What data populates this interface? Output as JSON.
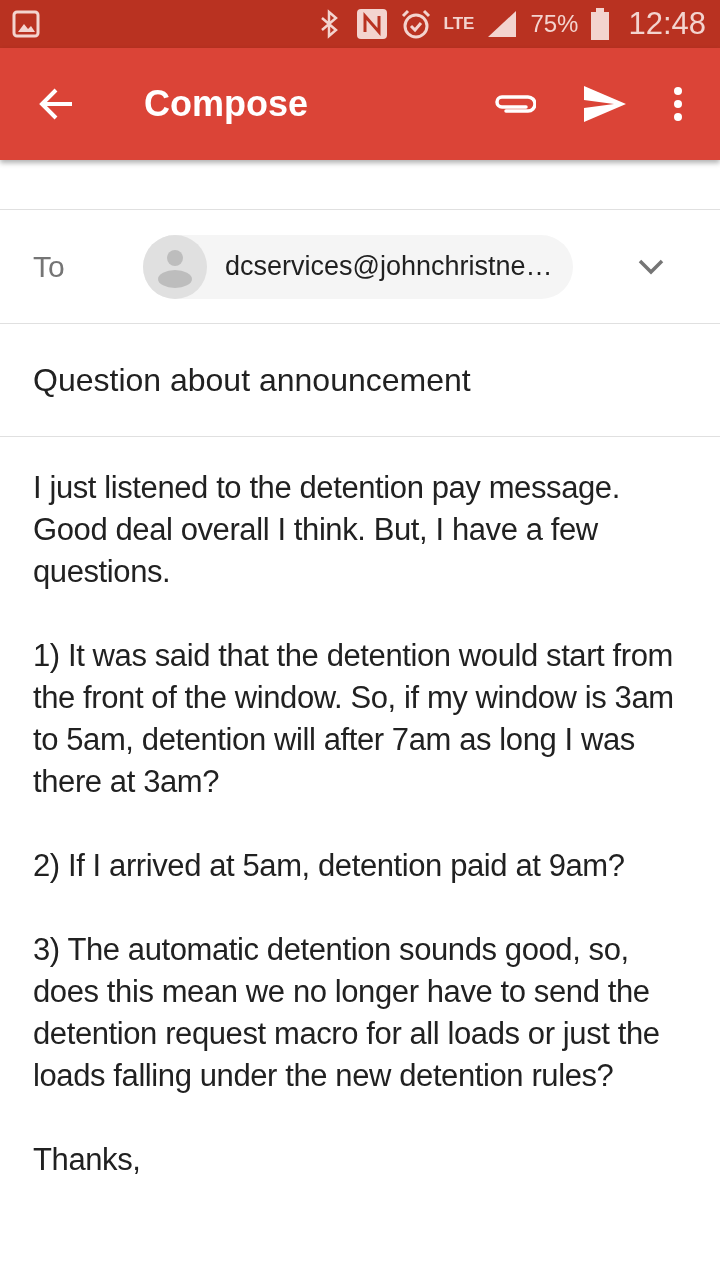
{
  "status_bar": {
    "network": "LTE",
    "battery": "75%",
    "time": "12:48"
  },
  "app_bar": {
    "title": "Compose"
  },
  "to": {
    "label": "To",
    "recipient": "dcservices@johnchristne…"
  },
  "subject": "Question about announcement",
  "body": [
    "I just listened to the detention pay message. Good deal overall I think. But, I have a few questions.",
    "1) It was said that the detention would start from the front of the window. So, if my window is 3am to 5am, detention will after 7am as long I was there at 3am?",
    "2) If I arrived at 5am, detention paid at 9am?",
    "3) The automatic detention sounds good, so, does this mean we no longer have to send the detention request macro for all loads or just the loads falling under the new detention rules?",
    "Thanks,"
  ]
}
